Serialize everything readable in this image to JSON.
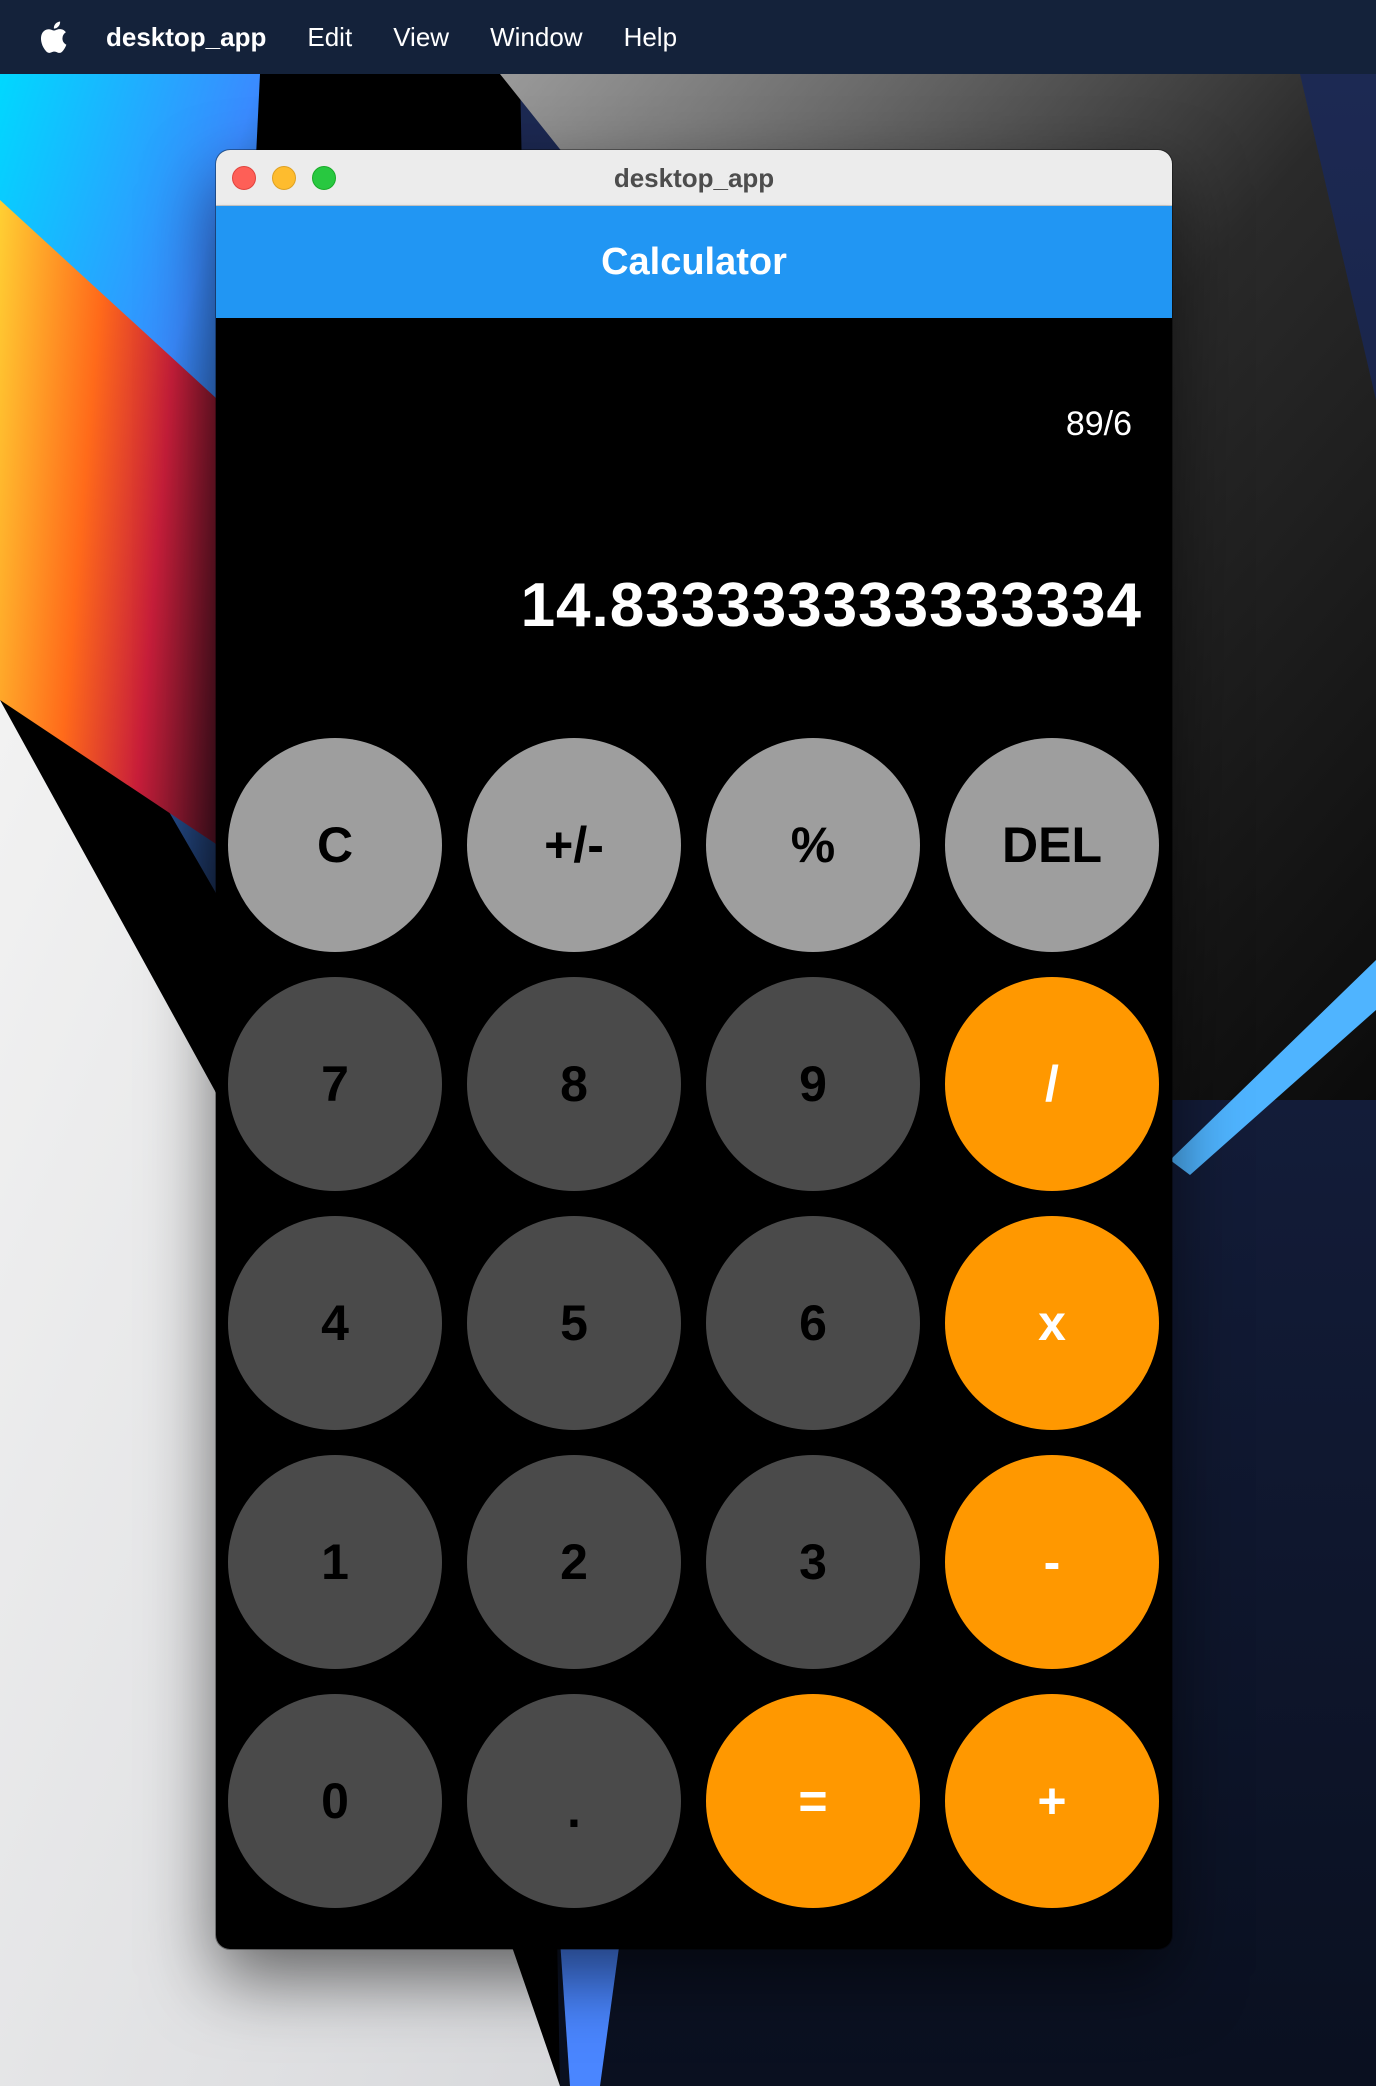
{
  "menubar": {
    "app_name": "desktop_app",
    "items": [
      "Edit",
      "View",
      "Window",
      "Help"
    ]
  },
  "window": {
    "title": "desktop_app",
    "appbar_title": "Calculator",
    "appbar_color": "#2196f3"
  },
  "display": {
    "expression": "89/6",
    "result": "14.833333333333334"
  },
  "keypad": {
    "rows": [
      [
        {
          "label": "C",
          "kind": "function"
        },
        {
          "label": "+/-",
          "kind": "function"
        },
        {
          "label": "%",
          "kind": "function"
        },
        {
          "label": "DEL",
          "kind": "function"
        }
      ],
      [
        {
          "label": "7",
          "kind": "digit"
        },
        {
          "label": "8",
          "kind": "digit"
        },
        {
          "label": "9",
          "kind": "digit"
        },
        {
          "label": "/",
          "kind": "operator"
        }
      ],
      [
        {
          "label": "4",
          "kind": "digit"
        },
        {
          "label": "5",
          "kind": "digit"
        },
        {
          "label": "6",
          "kind": "digit"
        },
        {
          "label": "x",
          "kind": "operator"
        }
      ],
      [
        {
          "label": "1",
          "kind": "digit"
        },
        {
          "label": "2",
          "kind": "digit"
        },
        {
          "label": "3",
          "kind": "digit"
        },
        {
          "label": "-",
          "kind": "operator"
        }
      ],
      [
        {
          "label": "0",
          "kind": "digit"
        },
        {
          "label": ".",
          "kind": "digit"
        },
        {
          "label": "=",
          "kind": "operator"
        },
        {
          "label": "+",
          "kind": "operator"
        }
      ]
    ],
    "colors": {
      "function": "#9e9e9e",
      "digit": "#4a4a4a",
      "operator": "#ff9800"
    }
  },
  "icons": {
    "apple": "apple-logo-icon",
    "close": "close-icon",
    "minimize": "minimize-icon",
    "zoom": "zoom-icon"
  }
}
